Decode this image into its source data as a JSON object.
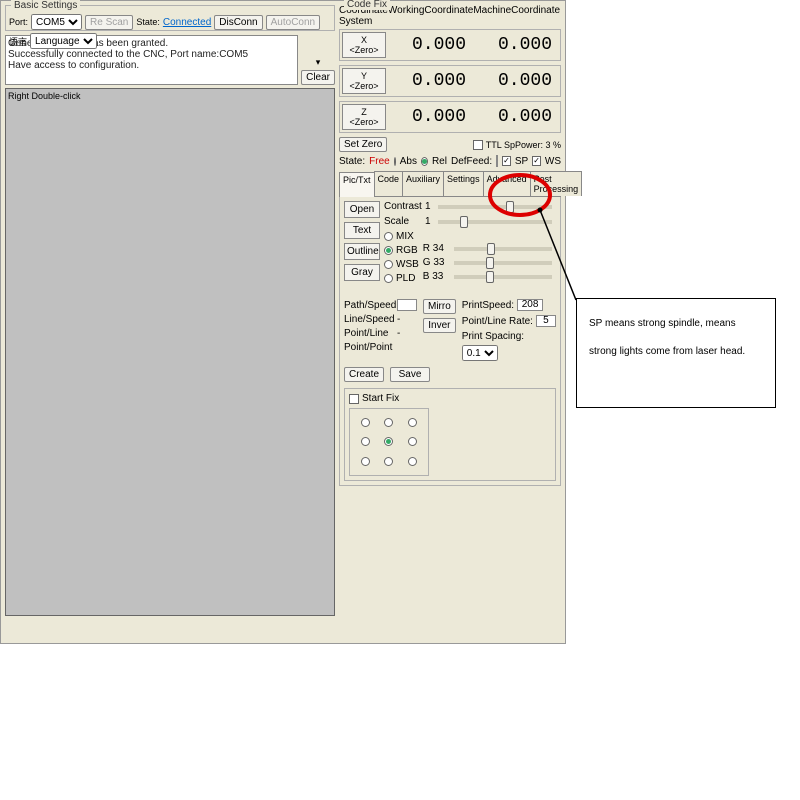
{
  "basic": {
    "title": "Basic Settings",
    "port_label": "Port:",
    "port_value": "COM5",
    "rescan": "Re Scan",
    "state_label": "State:",
    "state_value": "Connected",
    "disconn": "DisConn",
    "autoconn": "AutoConn",
    "lang_cn": "语言",
    "lang_en": "Language"
  },
  "log": {
    "l1": "General authority has been granted.",
    "l2": "Successfully connected to the CNC, Port name:COM5",
    "l3": "Have access to configuration.",
    "clear": "Clear"
  },
  "canvas_hint": "Right Double-click",
  "coord": {
    "system": "Coordinate System",
    "working": "WorkingCoordinate",
    "machine": "MachineCoordinate",
    "x_btn": "X <Zero>",
    "y_btn": "Y <Zero>",
    "z_btn": "Z <Zero>",
    "x_w": "0.000",
    "x_m": "0.000",
    "y_w": "0.000",
    "y_m": "0.000",
    "z_w": "0.000",
    "z_m": "0.000",
    "set_zero": "Set Zero",
    "ttl": "TTL SpPower: 3 %",
    "state_lbl": "State:",
    "state_val": "Free",
    "abs": "Abs",
    "rel": "Rel",
    "deffeed": "DefFeed:",
    "sp": "SP",
    "ws": "WS"
  },
  "tabs": {
    "t1": "Pic/Txt",
    "t2": "Code",
    "t3": "Auxiliary",
    "t4": "Settings",
    "t5": "Advanced",
    "t6": "Post Processing"
  },
  "pic": {
    "open": "Open",
    "text": "Text",
    "outline": "Outline",
    "gray": "Gray",
    "contrast": "Contrast",
    "contrast_v": "1",
    "scale": "Scale",
    "scale_v": "1",
    "mix": "MIX",
    "rgb": "RGB",
    "wsb": "WSB",
    "pld": "PLD",
    "r_lbl": "R 34",
    "g_lbl": "G 33",
    "b_lbl": "B 33"
  },
  "speed": {
    "pathspeed": "Path/Speed",
    "linespeed": "Line/Speed",
    "pointline": "Point/Line",
    "pointpoint": "Point/Point",
    "val": "-",
    "mirro": "Mirro",
    "inver": "Inver",
    "printspeed_l": "PrintSpeed:",
    "printspeed_v": "208",
    "plrate_l": "Point/Line Rate:",
    "plrate_v": "5",
    "printspacing_l": "Print Spacing:",
    "printspacing_v": "0.1",
    "create": "Create",
    "save": "Save"
  },
  "codefix": {
    "title": "Code Fix",
    "startfix": "Start Fix"
  },
  "annotation": "SP means strong spindle, means strong lights come from laser head."
}
